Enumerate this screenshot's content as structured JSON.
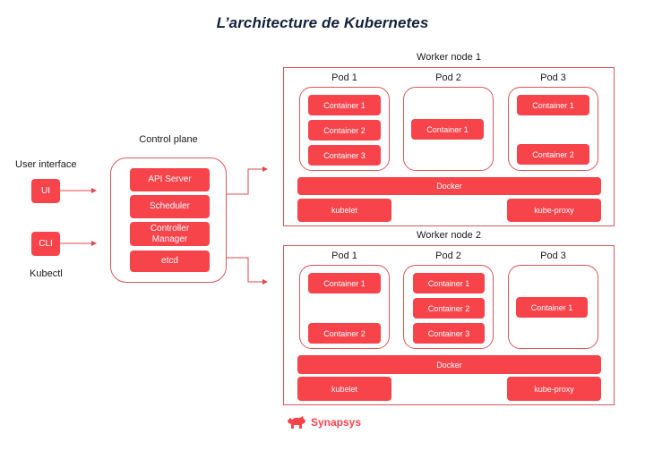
{
  "title": "L’architecture de Kubernetes",
  "colors": {
    "accent": "#f7434a",
    "border": "#d9565c",
    "title": "#14213a"
  },
  "user_interface": {
    "label": "User interface",
    "ui_label": "UI",
    "cli_label": "CLI",
    "kubectl_label": "Kubectl"
  },
  "control_plane": {
    "label": "Control plane",
    "components": [
      "API Server",
      "Scheduler",
      "Controller Manager",
      "etcd"
    ]
  },
  "worker_nodes": [
    {
      "label": "Worker node 1",
      "pods": [
        {
          "label": "Pod 1",
          "containers": [
            "Container 1",
            "Container 2",
            "Container 3"
          ]
        },
        {
          "label": "Pod 2",
          "containers": [
            "Container 1"
          ]
        },
        {
          "label": "Pod 3",
          "containers": [
            "Container 1",
            "Container 2"
          ]
        }
      ],
      "runtime": "Docker",
      "kubelet": "kubelet",
      "kube_proxy": "kube-proxy"
    },
    {
      "label": "Worker node 2",
      "pods": [
        {
          "label": "Pod 1",
          "containers": [
            "Container 1",
            "Container 2"
          ]
        },
        {
          "label": "Pod 2",
          "containers": [
            "Container 1",
            "Container 2",
            "Container 3"
          ]
        },
        {
          "label": "Pod 3",
          "containers": [
            "Container 1"
          ]
        }
      ],
      "runtime": "Docker",
      "kubelet": "kubelet",
      "kube_proxy": "kube-proxy"
    }
  ],
  "logo": {
    "icon": "rhino-icon",
    "text": "Synapsys"
  }
}
